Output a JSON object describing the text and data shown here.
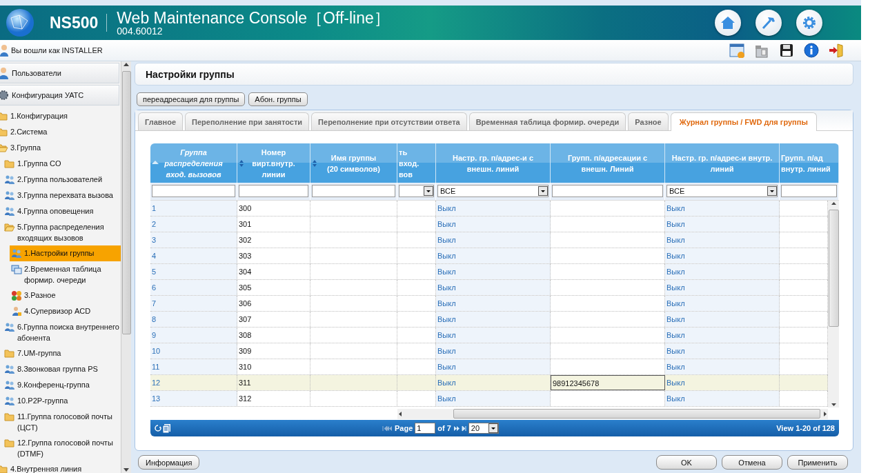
{
  "header": {
    "product": "NS500",
    "title": "Web Maintenance Console［Off-line］",
    "version": "004.60012"
  },
  "login": "Вы вошли как INSTALLER",
  "sidebar": {
    "sections": [
      {
        "label": "Пользователи",
        "kind": "users"
      },
      {
        "label": "Конфигурация УАТС",
        "kind": "config"
      }
    ],
    "tree": [
      {
        "label": "1.Конфигурация",
        "kind": "folder",
        "expanded": false
      },
      {
        "label": "2.Система",
        "kind": "folder",
        "expanded": false
      },
      {
        "label": "3.Группа",
        "kind": "folder",
        "expanded": true,
        "children": [
          {
            "label": "1.Группа CO",
            "kind": "folder",
            "expanded": false
          },
          {
            "label": "2.Группа пользователей",
            "kind": "people"
          },
          {
            "label": "3.Группа перехвата вызова",
            "kind": "people"
          },
          {
            "label": "4.Группа оповещения",
            "kind": "people"
          },
          {
            "label": "5.Группа распределения входящих вызовов",
            "kind": "folder",
            "expanded": true,
            "children": [
              {
                "label": "1.Настройки группы",
                "kind": "people",
                "selected": true
              },
              {
                "label": "2.Временная таблица формир. очереди",
                "kind": "windows",
                "selected": false
              },
              {
                "label": "3.Разное",
                "kind": "balls",
                "selected": false
              },
              {
                "label": "4.Супервизор ACD",
                "kind": "person",
                "selected": false
              }
            ]
          },
          {
            "label": "6.Группа поиска внутреннего абонента",
            "kind": "people"
          },
          {
            "label": "7.UM-группа",
            "kind": "folder",
            "expanded": false
          },
          {
            "label": "8.Звонковая группа PS",
            "kind": "people"
          },
          {
            "label": "9.Конференц-группа",
            "kind": "people"
          },
          {
            "label": "10.P2P-группа",
            "kind": "people"
          },
          {
            "label": "11.Группа голосовой почты (ЦСТ)",
            "kind": "folder",
            "expanded": false
          },
          {
            "label": "12.Группа голосовой почты (DTMF)",
            "kind": "folder",
            "expanded": false
          }
        ]
      },
      {
        "label": "4.Внутренняя линия",
        "kind": "folder",
        "expanded": false
      }
    ]
  },
  "page_title": "Настройки группы",
  "sub_buttons": [
    "переадресация для группы",
    "Абон. группы"
  ],
  "tabs": [
    {
      "label": "Главное",
      "selected": false
    },
    {
      "label": "Переполнение при занятости",
      "selected": false
    },
    {
      "label": "Переполнение при отсутствии ответа",
      "selected": false
    },
    {
      "label": "Временная таблица формир. очереди",
      "selected": false
    },
    {
      "label": "Разное",
      "selected": false
    },
    {
      "label": "Журнал группы / FWD для группы",
      "selected": true
    }
  ],
  "table": {
    "columns": [
      {
        "lines": [
          "Группа",
          "распределения",
          "вход. вызовов"
        ],
        "sorted": true,
        "filter": {
          "kind": "text"
        }
      },
      {
        "lines": [
          "Номер",
          "вирт.внутр.",
          "линии"
        ],
        "sorted": false,
        "filter": {
          "kind": "text"
        }
      },
      {
        "lines": [
          "Имя группы",
          "(20 символов)"
        ],
        "sorted": false,
        "filter": {
          "kind": "text"
        }
      },
      {
        "lines": [
          "ть",
          "вход.",
          "вов"
        ],
        "filter": {
          "kind": "select"
        }
      },
      {
        "lines": [
          "Настр. гр. п/адрес-и с",
          "внешн. линий"
        ],
        "filter": {
          "kind": "select",
          "value": "ВСЕ"
        }
      },
      {
        "lines": [
          "Групп. п/адресации с",
          "внешн. Линий"
        ],
        "filter": {
          "kind": "text"
        }
      },
      {
        "lines": [
          "Настр. гр. п/адрес-и внутр.",
          "линий"
        ],
        "filter": {
          "kind": "select",
          "value": "ВСЕ"
        }
      },
      {
        "lines": [
          "Групп. п/ад",
          "внутр. линий"
        ],
        "filter": {
          "kind": "text"
        }
      }
    ],
    "rows": [
      {
        "group": "1",
        "number": "300",
        "ext_fwd": "Выкл",
        "int_fwd": "Выкл",
        "selected": false
      },
      {
        "group": "2",
        "number": "301",
        "ext_fwd": "Выкл",
        "int_fwd": "Выкл",
        "selected": false
      },
      {
        "group": "3",
        "number": "302",
        "ext_fwd": "Выкл",
        "int_fwd": "Выкл",
        "selected": false
      },
      {
        "group": "4",
        "number": "303",
        "ext_fwd": "Выкл",
        "int_fwd": "Выкл",
        "selected": false
      },
      {
        "group": "5",
        "number": "304",
        "ext_fwd": "Выкл",
        "int_fwd": "Выкл",
        "selected": false
      },
      {
        "group": "6",
        "number": "305",
        "ext_fwd": "Выкл",
        "int_fwd": "Выкл",
        "selected": false
      },
      {
        "group": "7",
        "number": "306",
        "ext_fwd": "Выкл",
        "int_fwd": "Выкл",
        "selected": false
      },
      {
        "group": "8",
        "number": "307",
        "ext_fwd": "Выкл",
        "int_fwd": "Выкл",
        "selected": false
      },
      {
        "group": "9",
        "number": "308",
        "ext_fwd": "Выкл",
        "int_fwd": "Выкл",
        "selected": false
      },
      {
        "group": "10",
        "number": "309",
        "ext_fwd": "Выкл",
        "int_fwd": "Выкл",
        "selected": false
      },
      {
        "group": "11",
        "number": "310",
        "ext_fwd": "Выкл",
        "int_fwd": "Выкл",
        "selected": false
      },
      {
        "group": "12",
        "number": "311",
        "ext_fwd": "Выкл",
        "ext_dest": "98912345678",
        "int_fwd": "Выкл",
        "selected": true
      },
      {
        "group": "13",
        "number": "312",
        "ext_fwd": "Выкл",
        "int_fwd": "Выкл",
        "selected": false
      }
    ]
  },
  "pager": {
    "page_label": "Page",
    "page": "1",
    "of": "of 7",
    "per_page": "20",
    "view": "View 1-20 of 128"
  },
  "buttons": {
    "left": [
      "Информация"
    ],
    "right": [
      "OK",
      "Отмена",
      "Применить"
    ]
  }
}
